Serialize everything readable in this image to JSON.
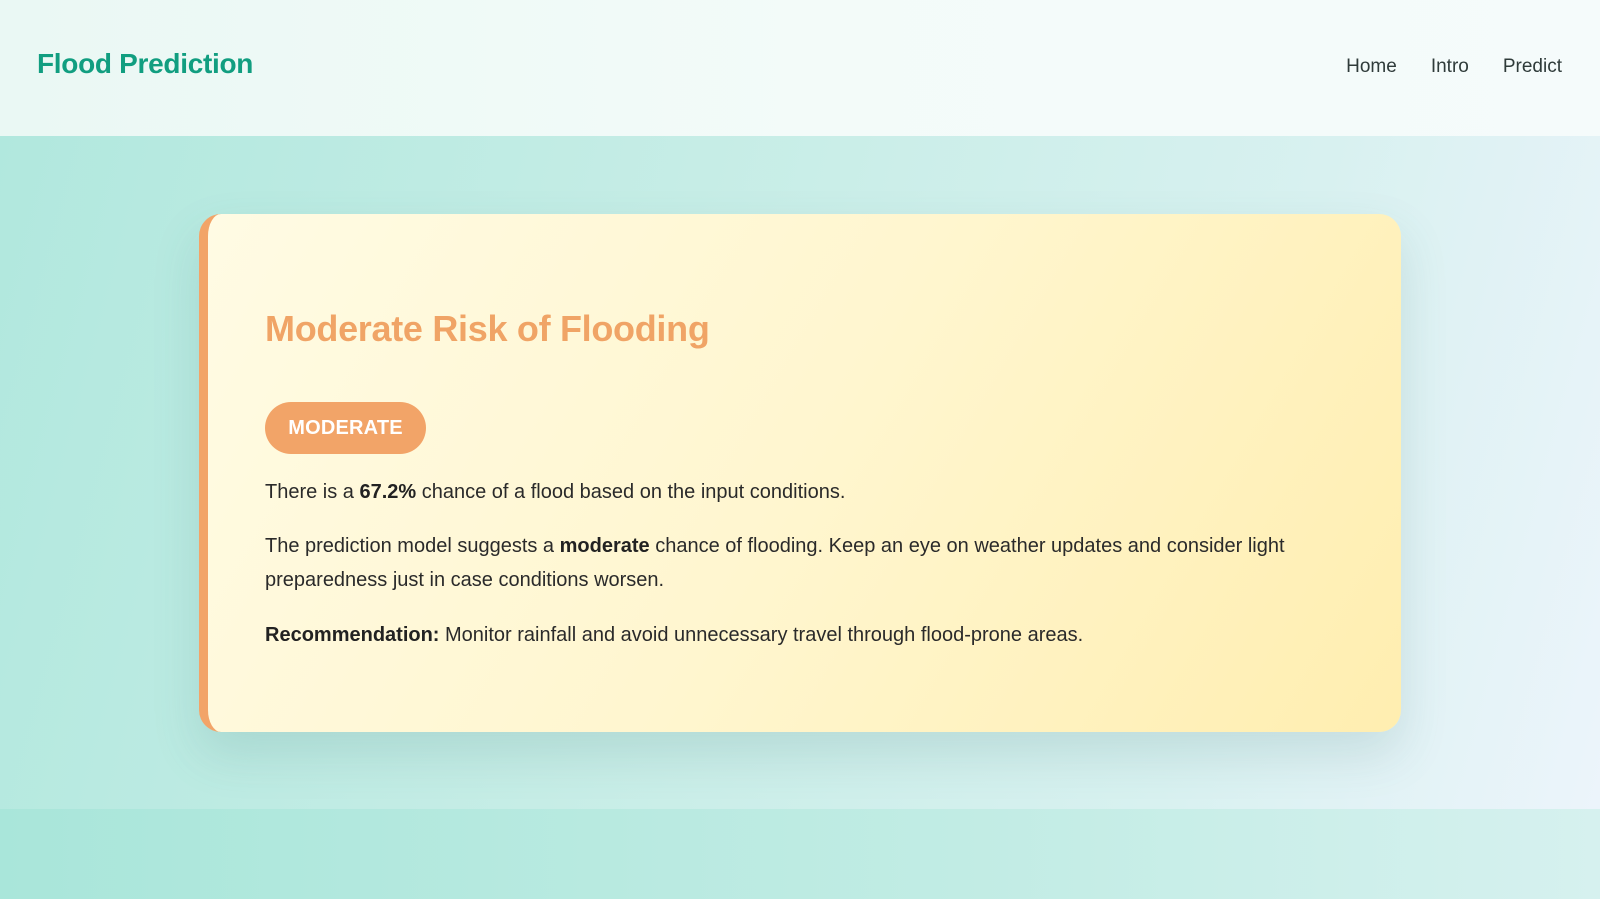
{
  "navbar": {
    "brand": "Flood Prediction",
    "links": [
      "Home",
      "Intro",
      "Predict"
    ]
  },
  "result": {
    "title": "Moderate Risk of Flooding",
    "badge": "MODERATE",
    "probability": {
      "prefix": "There is a ",
      "value": "67.2%",
      "suffix": " chance of a flood based on the input conditions."
    },
    "description": {
      "prefix": "The prediction model suggests a ",
      "emphasis": "moderate",
      "suffix": " chance of flooding. Keep an eye on weather updates and consider light preparedness just in case conditions worsen."
    },
    "recommendation": {
      "label": "Recommendation:",
      "text": " Monitor rainfall and avoid unnecessary travel through flood-prone areas."
    }
  },
  "colors": {
    "brand": "#119e80",
    "moderate_accent": "#f2a468",
    "title": "#f0a466",
    "card_bg": "#fff6cf"
  }
}
